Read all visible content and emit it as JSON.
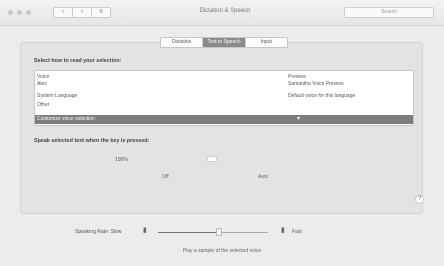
{
  "window": {
    "title": "Dictation & Speech",
    "search_placeholder": "Search"
  },
  "toolbar": {
    "back_label": "‹",
    "forward_label": "›",
    "grid_label": "≡"
  },
  "tabs": [
    "Dictation",
    "Text to Speech",
    "Input"
  ],
  "active_tab": 1,
  "section1": {
    "title": "Select how to read your selection:",
    "rows": [
      {
        "c1": "Voice",
        "c2": "Preview"
      },
      {
        "c1": "Alex",
        "c2": "Samantha Voice Preview"
      },
      {
        "c1": "System Language",
        "c2": "Default voice for this language"
      },
      {
        "c1": "Other",
        "c2": ""
      },
      {
        "c1": "Customize voice selection",
        "c2": "▾"
      }
    ]
  },
  "section2": {
    "title": "Speak selected text when the key is pressed:",
    "rate_value": "100%",
    "option_left": "Off",
    "option_right": "Auto"
  },
  "help_label": "?",
  "slider": {
    "label_left": "Speaking Rate: Slow",
    "label_right": "Fast",
    "value": 0.55
  },
  "status_text": "Play a sample of the selected voice"
}
